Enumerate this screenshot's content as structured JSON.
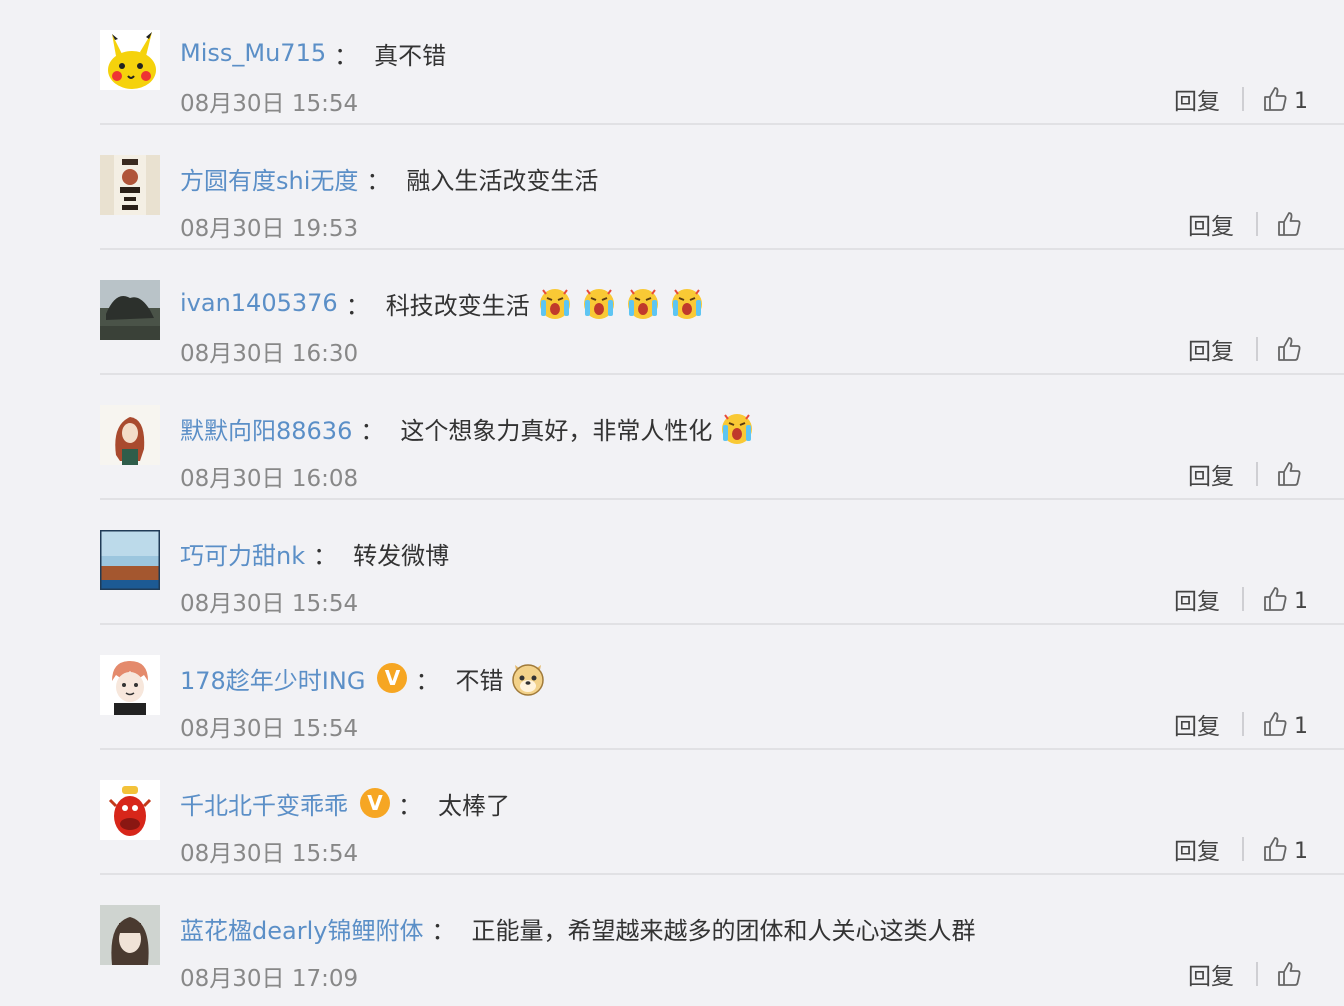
{
  "colors": {
    "background": "#f2f2f5",
    "username": "#5b8fc7",
    "text": "#333333",
    "timestamp": "#888888",
    "verified_badge": "#f6a623",
    "divider": "#e1e1e4"
  },
  "reply_label": "回复",
  "colon": "：",
  "verified_badge_letter": "V",
  "comments": [
    {
      "username": "Miss_Mu715",
      "verified": false,
      "text": "真不错",
      "emojis": [],
      "time": "08月30日 15:54",
      "likes": "1",
      "avatar_icon": "pikachu-avatar"
    },
    {
      "username": "方圆有度shi无度",
      "verified": false,
      "text": "融入生活改变生活",
      "emojis": [],
      "time": "08月30日 19:53",
      "likes": "",
      "avatar_icon": "calligraphy-avatar"
    },
    {
      "username": "ivan1405376",
      "verified": false,
      "text": "科技改变生活",
      "emojis": [
        "crying-face-emoji",
        "crying-face-emoji",
        "crying-face-emoji",
        "crying-face-emoji"
      ],
      "time": "08月30日 16:30",
      "likes": "",
      "avatar_icon": "landscape-avatar"
    },
    {
      "username": "默默向阳88636",
      "verified": false,
      "text": "这个想象力真好，非常人性化",
      "emojis": [
        "crying-face-emoji"
      ],
      "time": "08月30日 16:08",
      "likes": "",
      "avatar_icon": "girl-illustration-avatar"
    },
    {
      "username": "巧可力甜nk",
      "verified": false,
      "text": "转发微博",
      "emojis": [],
      "time": "08月30日 15:54",
      "likes": "1",
      "avatar_icon": "scenery-avatar"
    },
    {
      "username": "178趁年少时ING",
      "verified": true,
      "text": "不错",
      "emojis": [
        "doge-emoji"
      ],
      "time": "08月30日 15:54",
      "likes": "1",
      "avatar_icon": "anime-boy-avatar"
    },
    {
      "username": "千北北千变乖乖",
      "verified": true,
      "text": "太棒了",
      "emojis": [],
      "time": "08月30日 15:54",
      "likes": "1",
      "avatar_icon": "red-cartoon-avatar"
    },
    {
      "username": "蓝花楹dearly锦鲤附体",
      "verified": false,
      "text": "正能量，希望越来越多的团体和人关心这类人群",
      "emojis": [],
      "time": "08月30日 17:09",
      "likes": "",
      "avatar_icon": "girl-photo-avatar"
    }
  ]
}
